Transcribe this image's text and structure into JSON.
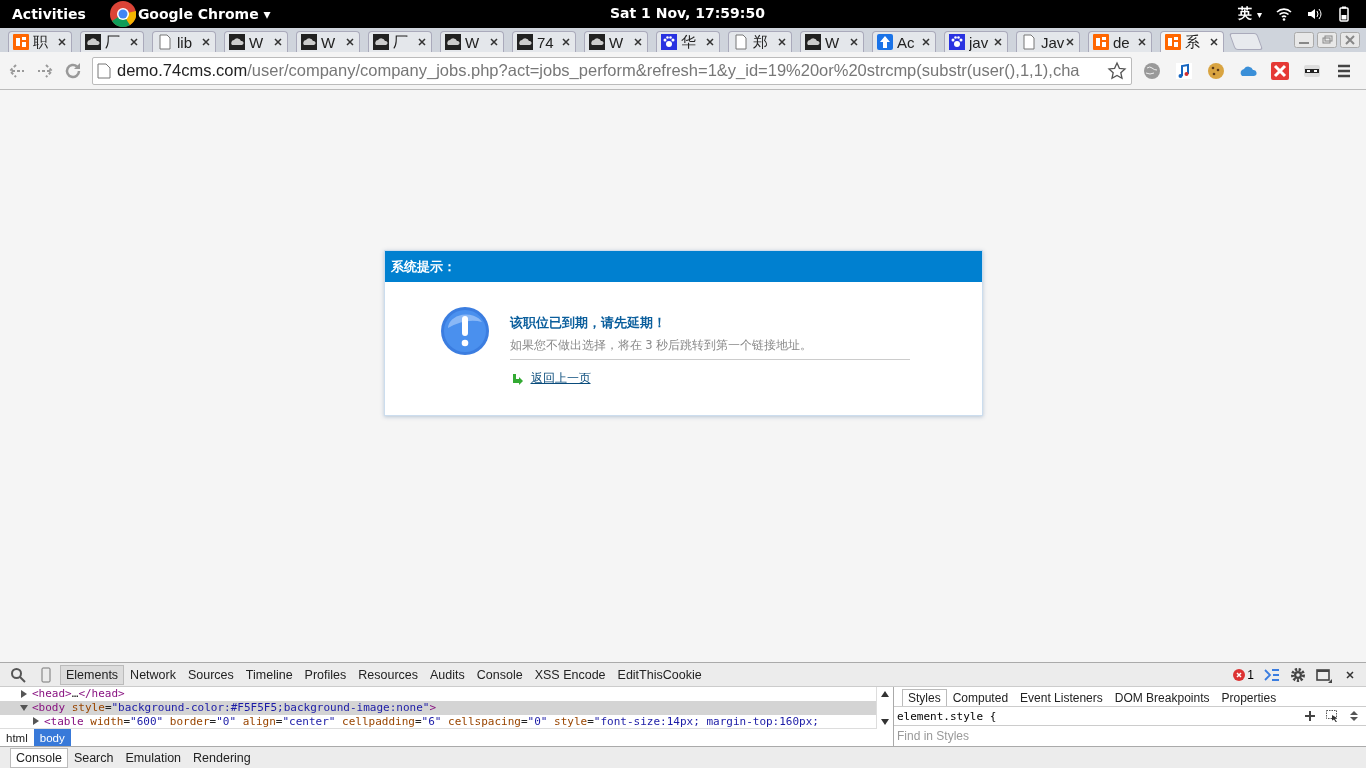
{
  "top_bar": {
    "activities": "Activities",
    "app_name": "Google Chrome",
    "app_caret": "▾",
    "clock": "Sat  1 Nov, 17:59:50",
    "input_method": "英",
    "input_caret": "▾"
  },
  "tabs": [
    {
      "kind": "pin",
      "title": "职",
      "selected": false
    },
    {
      "kind": "cloud",
      "title": "厂",
      "selected": false
    },
    {
      "kind": "page",
      "title": "lib",
      "selected": false
    },
    {
      "kind": "cloud",
      "title": "W",
      "selected": false
    },
    {
      "kind": "cloud",
      "title": "W",
      "selected": false
    },
    {
      "kind": "cloud",
      "title": "厂",
      "selected": false
    },
    {
      "kind": "cloud",
      "title": "W",
      "selected": false
    },
    {
      "kind": "cloud",
      "title": "74",
      "selected": false
    },
    {
      "kind": "cloud",
      "title": "W",
      "selected": false
    },
    {
      "kind": "paw",
      "title": "华",
      "selected": false
    },
    {
      "kind": "page",
      "title": "郑",
      "selected": false
    },
    {
      "kind": "cloud",
      "title": "W",
      "selected": false
    },
    {
      "kind": "arrow",
      "title": "Ac",
      "selected": false
    },
    {
      "kind": "paw",
      "title": "jav",
      "selected": false
    },
    {
      "kind": "page",
      "title": "Jav",
      "selected": false
    },
    {
      "kind": "pin",
      "title": "de",
      "selected": false
    },
    {
      "kind": "pin",
      "title": "系",
      "selected": true
    }
  ],
  "address_bar": {
    "host": "demo.74cms.com",
    "path": "/user/company/company_jobs.php?act=jobs_perform&refresh=1&y_id=19%20or%20strcmp(substr(user(),1,1),cha"
  },
  "dialog": {
    "title": "系统提示：",
    "heading": "该职位已到期，请先延期！",
    "message": "如果您不做出选择，将在 3 秒后跳转到第一个链接地址。",
    "link": "返回上一页"
  },
  "devtools": {
    "tabs": [
      {
        "label": "Elements",
        "selected": true
      },
      {
        "label": "Network",
        "selected": false
      },
      {
        "label": "Sources",
        "selected": false
      },
      {
        "label": "Timeline",
        "selected": false
      },
      {
        "label": "Profiles",
        "selected": false
      },
      {
        "label": "Resources",
        "selected": false
      },
      {
        "label": "Audits",
        "selected": false
      },
      {
        "label": "Console",
        "selected": false
      },
      {
        "label": "XSS Encode",
        "selected": false
      },
      {
        "label": "EditThisCookie",
        "selected": false
      }
    ],
    "error_count": "1",
    "dom_lines": [
      {
        "expanded": false,
        "selected": false,
        "parts": [
          {
            "kind": "tag",
            "text": "<head>"
          },
          {
            "kind": "text",
            "text": "…"
          },
          {
            "kind": "tag",
            "text": "</head>"
          }
        ]
      },
      {
        "expanded": true,
        "selected": true,
        "parts": [
          {
            "kind": "tag",
            "text": "<body "
          },
          {
            "kind": "attr",
            "text": "style"
          },
          {
            "kind": "text",
            "text": "="
          },
          {
            "kind": "value",
            "text": "\"background-color:#F5F5F5;background-image:none\""
          },
          {
            "kind": "tag",
            "text": ">"
          }
        ]
      },
      {
        "expanded": false,
        "selected": false,
        "parts": [
          {
            "kind": "tag",
            "text": "<table "
          },
          {
            "kind": "attr",
            "text": "width"
          },
          {
            "kind": "text",
            "text": "="
          },
          {
            "kind": "value",
            "text": "\"600\" "
          },
          {
            "kind": "attr",
            "text": "border"
          },
          {
            "kind": "text",
            "text": "="
          },
          {
            "kind": "value",
            "text": "\"0\" "
          },
          {
            "kind": "attr",
            "text": "align"
          },
          {
            "kind": "text",
            "text": "="
          },
          {
            "kind": "value",
            "text": "\"center\" "
          },
          {
            "kind": "attr",
            "text": "cellpadding"
          },
          {
            "kind": "text",
            "text": "="
          },
          {
            "kind": "value",
            "text": "\"6\" "
          },
          {
            "kind": "attr",
            "text": "cellspacing"
          },
          {
            "kind": "text",
            "text": "="
          },
          {
            "kind": "value",
            "text": "\"0\" "
          },
          {
            "kind": "attr",
            "text": "style"
          },
          {
            "kind": "text",
            "text": "="
          },
          {
            "kind": "value",
            "text": "\"font-size:14px; margin-top:160px;"
          }
        ]
      }
    ],
    "breadcrumbs": [
      {
        "label": "html",
        "selected": false
      },
      {
        "label": "body",
        "selected": true
      }
    ],
    "side_tabs": [
      {
        "label": "Styles",
        "selected": true
      },
      {
        "label": "Computed",
        "selected": false
      },
      {
        "label": "Event Listeners",
        "selected": false
      },
      {
        "label": "DOM Breakpoints",
        "selected": false
      },
      {
        "label": "Properties",
        "selected": false
      }
    ],
    "style_rule": "element.style {",
    "find_placeholder": "Find in Styles",
    "drawer_tabs": [
      {
        "label": "Console",
        "selected": true
      },
      {
        "label": "Search",
        "selected": false
      },
      {
        "label": "Emulation",
        "selected": false
      },
      {
        "label": "Rendering",
        "selected": false
      }
    ]
  }
}
